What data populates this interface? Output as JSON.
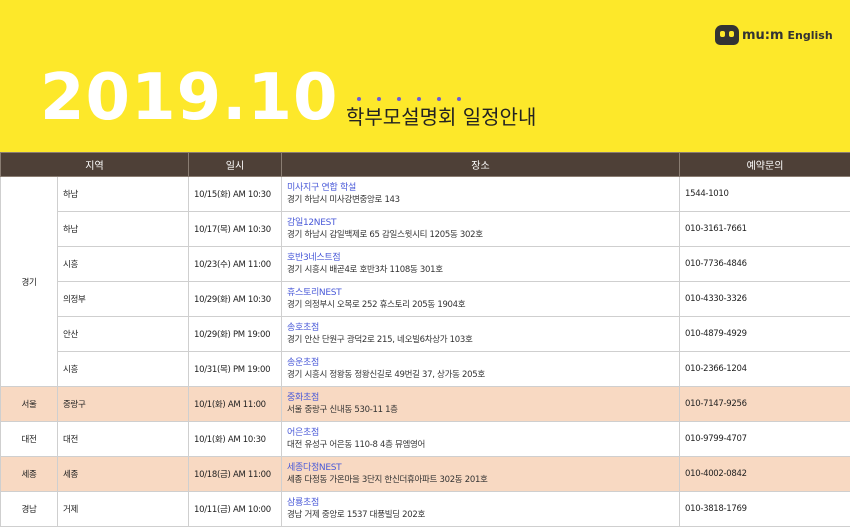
{
  "logo": {
    "text": "mu:m",
    "sub": "English"
  },
  "header": {
    "date": "2019.10",
    "subtitle": "학부모설명회 일정안내"
  },
  "table": {
    "columns": [
      "지역",
      "일시",
      "장소",
      "예약문의"
    ],
    "groups": [
      {
        "region": "경기",
        "rows": [
          {
            "district": "하남",
            "datetime": "10/15(화) AM 10:30",
            "venue": "미사지구 연합 학설",
            "address": "경기 하남시 미사강변중앙로 143",
            "phone": "1544-1010"
          },
          {
            "district": "하남",
            "datetime": "10/17(목) AM 10:30",
            "venue": "감일12NEST",
            "address": "경기 하남시 감일백제로 65 감일스윗시티 1205동 302호",
            "phone": "010-3161-7661"
          },
          {
            "district": "시흥",
            "datetime": "10/23(수) AM 11:00",
            "venue": "호반3네스트점",
            "address": "경기 시흥시 배곧4로 호반3차 1108동 301호",
            "phone": "010-7736-4846"
          },
          {
            "district": "의정부",
            "datetime": "10/29(화) AM 10:30",
            "venue": "휴스토리NEST",
            "address": "경기 의정부시 오목로 252 휴스토리 205동 1904호",
            "phone": "010-4330-3326"
          },
          {
            "district": "안산",
            "datetime": "10/29(화) PM 19:00",
            "venue": "송호초점",
            "address": "경기 안산 단원구 광덕2로 215, 네오빌6차상가 103호",
            "phone": "010-4879-4929"
          },
          {
            "district": "시흥",
            "datetime": "10/31(목) PM 19:00",
            "venue": "송운초점",
            "address": "경기 시흥시 정왕동 정왕신길로 49번길 37, 상가동 205호",
            "phone": "010-2366-1204"
          }
        ]
      },
      {
        "region": "서울",
        "highlight": true,
        "rows": [
          {
            "district": "중랑구",
            "datetime": "10/1(화) AM 11:00",
            "venue": "중화초점",
            "address": "서울 중랑구 신내동 530-11 1층",
            "phone": "010-7147-9256"
          }
        ]
      },
      {
        "region": "대전",
        "rows": [
          {
            "district": "대전",
            "datetime": "10/1(화) AM 10:30",
            "venue": "어은초점",
            "address": "대전 유성구 어은동 110-8 4층 뮤엠영어",
            "phone": "010-9799-4707"
          }
        ]
      },
      {
        "region": "세종",
        "highlight": true,
        "rows": [
          {
            "district": "세종",
            "datetime": "10/18(금) AM 11:00",
            "venue": "세종다정NEST",
            "address": "세종 다정동 가온마을 3단지 한신더휴아파트 302동 201호",
            "phone": "010-4002-0842"
          }
        ]
      },
      {
        "region": "경남",
        "rows": [
          {
            "district": "거제",
            "datetime": "10/11(금) AM 10:00",
            "venue": "삼룡초점",
            "address": "경남 거제 중앙로 1537 대풍빌딩 202호",
            "phone": "010-3818-1769"
          }
        ]
      }
    ]
  }
}
